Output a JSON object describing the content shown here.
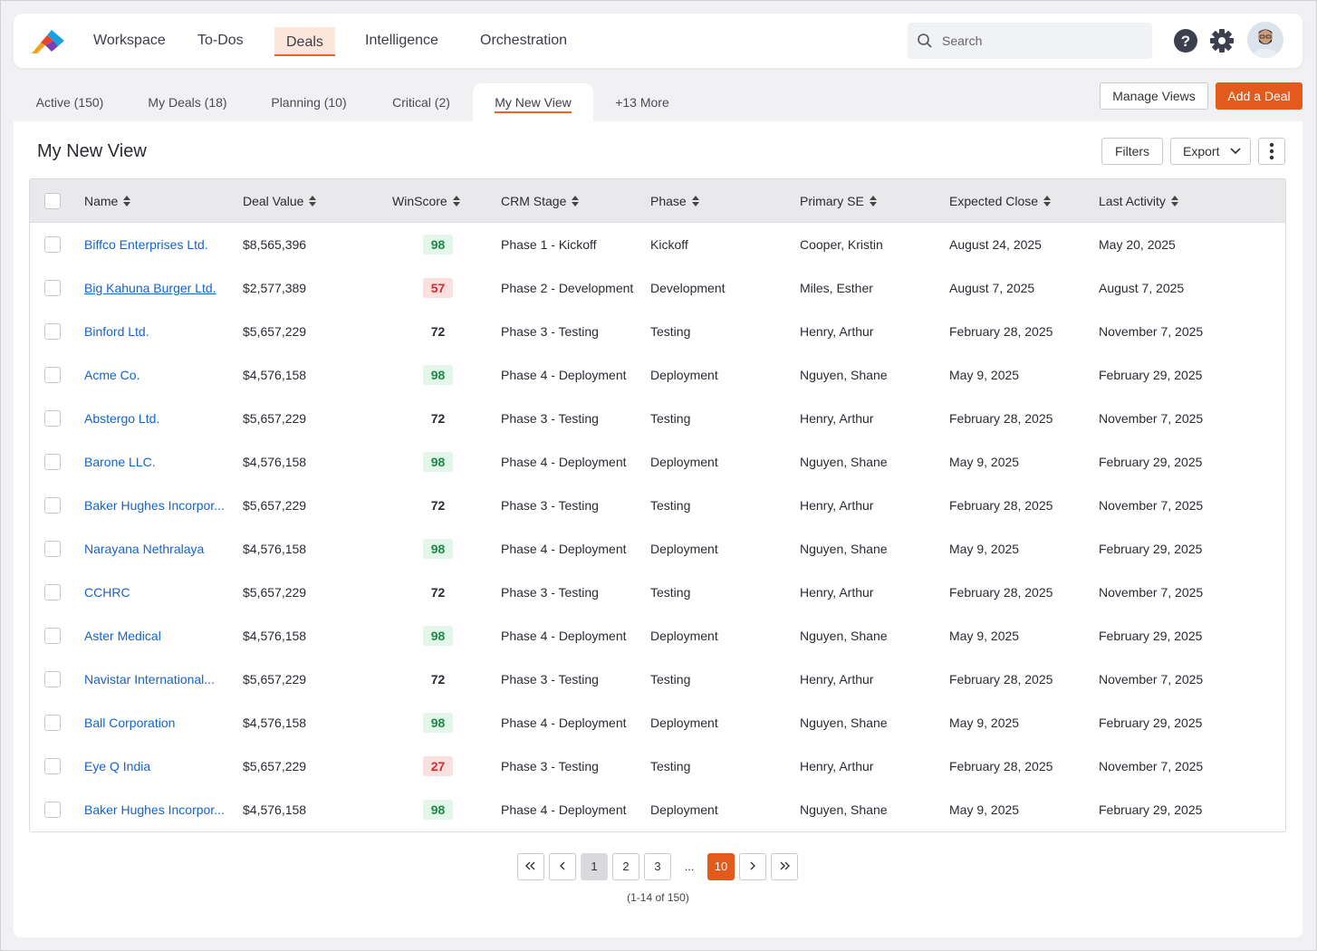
{
  "nav": {
    "items": [
      "Workspace",
      "To-Dos",
      "Deals",
      "Intelligence",
      "Orchestration"
    ],
    "active": "Deals"
  },
  "search": {
    "placeholder": "Search"
  },
  "tabs": {
    "items": [
      "Active (150)",
      "My Deals (18)",
      "Planning (10)",
      "Critical (2)",
      "My New View",
      "+13 More"
    ],
    "active": "My New View"
  },
  "actions": {
    "manage_views": "Manage Views",
    "add_deal": "Add a Deal"
  },
  "view": {
    "title": "My New View",
    "filters": "Filters",
    "export": "Export"
  },
  "table": {
    "columns": [
      "Name",
      "Deal Value",
      "WinScore",
      "CRM Stage",
      "Phase",
      "Primary SE",
      "Expected Close",
      "Last Activity"
    ],
    "rows": [
      {
        "name": "Biffco Enterprises Ltd.",
        "value": "$8,565,396",
        "score": "98",
        "level": "high",
        "stage": "Phase 1 - Kickoff",
        "phase": "Kickoff",
        "se": "Cooper, Kristin",
        "close": "August 24, 2025",
        "activity": "May 20, 2025"
      },
      {
        "name": "Big Kahuna Burger Ltd.",
        "value": "$2,577,389",
        "score": "57",
        "level": "low",
        "stage": "Phase 2 - Development",
        "phase": "Development",
        "se": "Miles, Esther",
        "close": "August 7, 2025",
        "activity": "August 7, 2025"
      },
      {
        "name": "Binford Ltd.",
        "value": "$5,657,229",
        "score": "72",
        "level": "mid",
        "stage": "Phase 3 - Testing",
        "phase": "Testing",
        "se": "Henry, Arthur",
        "close": "February 28, 2025",
        "activity": "November 7, 2025"
      },
      {
        "name": "Acme Co.",
        "value": "$4,576,158",
        "score": "98",
        "level": "high",
        "stage": "Phase 4 - Deployment",
        "phase": "Deployment",
        "se": "Nguyen, Shane",
        "close": "May 9, 2025",
        "activity": "February 29, 2025"
      },
      {
        "name": "Abstergo Ltd.",
        "value": "$5,657,229",
        "score": "72",
        "level": "mid",
        "stage": "Phase 3 - Testing",
        "phase": "Testing",
        "se": "Henry, Arthur",
        "close": "February 28, 2025",
        "activity": "November 7, 2025"
      },
      {
        "name": "Barone LLC.",
        "value": "$4,576,158",
        "score": "98",
        "level": "high",
        "stage": "Phase 4 - Deployment",
        "phase": "Deployment",
        "se": "Nguyen, Shane",
        "close": "May 9, 2025",
        "activity": "February 29, 2025"
      },
      {
        "name": "Baker Hughes Incorpor...",
        "value": "$5,657,229",
        "score": "72",
        "level": "mid",
        "stage": "Phase 3 - Testing",
        "phase": "Testing",
        "se": "Henry, Arthur",
        "close": "February 28, 2025",
        "activity": "November 7, 2025"
      },
      {
        "name": "Narayana Nethralaya",
        "value": "$4,576,158",
        "score": "98",
        "level": "high",
        "stage": "Phase 4 - Deployment",
        "phase": "Deployment",
        "se": "Nguyen, Shane",
        "close": "May 9, 2025",
        "activity": "February 29, 2025"
      },
      {
        "name": "CCHRC",
        "value": "$5,657,229",
        "score": "72",
        "level": "mid",
        "stage": "Phase 3 - Testing",
        "phase": "Testing",
        "se": "Henry, Arthur",
        "close": "February 28, 2025",
        "activity": "November 7, 2025"
      },
      {
        "name": "Aster Medical",
        "value": "$4,576,158",
        "score": "98",
        "level": "high",
        "stage": "Phase 4 - Deployment",
        "phase": "Deployment",
        "se": "Nguyen, Shane",
        "close": "May 9, 2025",
        "activity": "February 29, 2025"
      },
      {
        "name": "Navistar International...",
        "value": "$5,657,229",
        "score": "72",
        "level": "mid",
        "stage": "Phase 3 - Testing",
        "phase": "Testing",
        "se": "Henry, Arthur",
        "close": "February 28, 2025",
        "activity": "November 7, 2025"
      },
      {
        "name": "Ball Corporation",
        "value": "$4,576,158",
        "score": "98",
        "level": "high",
        "stage": "Phase 4 - Deployment",
        "phase": "Deployment",
        "se": "Nguyen, Shane",
        "close": "May 9, 2025",
        "activity": "February 29, 2025"
      },
      {
        "name": "Eye Q India",
        "value": "$5,657,229",
        "score": "27",
        "level": "low",
        "stage": "Phase 3 - Testing",
        "phase": "Testing",
        "se": "Henry, Arthur",
        "close": "February 28, 2025",
        "activity": "November 7, 2025"
      },
      {
        "name": "Baker Hughes Incorpor...",
        "value": "$4,576,158",
        "score": "98",
        "level": "high",
        "stage": "Phase 4 - Deployment",
        "phase": "Deployment",
        "se": "Nguyen, Shane",
        "close": "May 9, 2025",
        "activity": "February 29, 2025"
      }
    ]
  },
  "pagination": {
    "pages": [
      "1",
      "2",
      "3"
    ],
    "ellipsis": "...",
    "last_page": "10",
    "current": "1",
    "summary": "(1-14 of 150)"
  },
  "colors": {
    "accent": "#e35a1c",
    "link": "#1464c8"
  },
  "icons": [
    "search-icon",
    "help-icon",
    "gear-icon",
    "sort-icon",
    "chevron-down-icon",
    "more-vertical-icon"
  ]
}
